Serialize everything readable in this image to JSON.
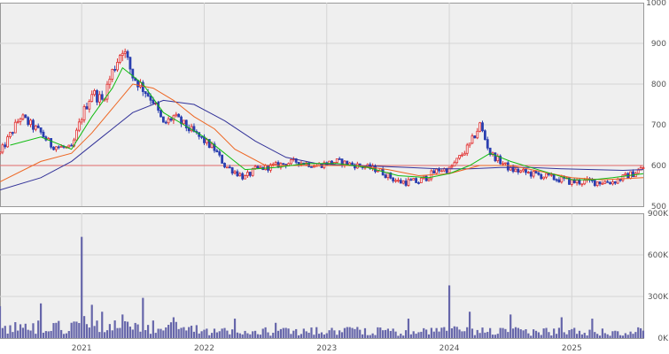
{
  "chart_data": [
    {
      "type": "candlestick",
      "panel": "price",
      "title": "",
      "x_tick_labels": [
        "2021",
        "2022",
        "2023",
        "2024",
        "2025"
      ],
      "x_range": [
        "2020-05",
        "2025-08"
      ],
      "y_ticks": [
        500,
        600,
        700,
        800,
        900,
        1000
      ],
      "y_tick_labels": [
        "500",
        "600",
        "700",
        "800",
        "900",
        "1000"
      ],
      "ylim": [
        500,
        1000
      ],
      "grid": true,
      "reference_line": 600,
      "close_series": {
        "x": [
          "2020-05",
          "2020-07",
          "2020-09",
          "2020-10",
          "2020-12",
          "2021-01",
          "2021-02",
          "2021-03",
          "2021-04",
          "2021-05",
          "2021-06",
          "2021-07",
          "2021-08",
          "2021-09",
          "2021-10",
          "2021-11",
          "2021-12",
          "2022-01",
          "2022-02",
          "2022-03",
          "2022-05",
          "2022-06",
          "2022-08",
          "2022-10",
          "2022-12",
          "2023-02",
          "2023-04",
          "2023-06",
          "2023-08",
          "2023-10",
          "2023-12",
          "2024-01",
          "2024-03",
          "2024-04",
          "2024-05",
          "2024-07",
          "2024-09",
          "2024-11",
          "2025-01",
          "2025-03",
          "2025-05",
          "2025-07",
          "2025-08"
        ],
        "y": [
          630,
          720,
          680,
          650,
          640,
          720,
          780,
          760,
          830,
          890,
          820,
          790,
          760,
          700,
          720,
          700,
          680,
          660,
          640,
          600,
          570,
          590,
          600,
          610,
          600,
          610,
          600,
          590,
          560,
          560,
          590,
          590,
          650,
          700,
          630,
          590,
          580,
          570,
          560,
          560,
          560,
          580,
          595
        ]
      },
      "ma_short": {
        "color": "#11bb11",
        "x": [
          "2020-06",
          "2020-09",
          "2020-12",
          "2021-02",
          "2021-04",
          "2021-05",
          "2021-07",
          "2021-09",
          "2021-11",
          "2022-01",
          "2022-03",
          "2022-05",
          "2022-08",
          "2022-11",
          "2023-02",
          "2023-05",
          "2023-08",
          "2023-11",
          "2024-01",
          "2024-03",
          "2024-05",
          "2024-07",
          "2024-09",
          "2024-11",
          "2025-01",
          "2025-03",
          "2025-05",
          "2025-08"
        ],
        "y": [
          650,
          670,
          640,
          720,
          790,
          840,
          800,
          730,
          700,
          670,
          630,
          590,
          595,
          605,
          605,
          595,
          575,
          570,
          580,
          600,
          630,
          610,
          595,
          580,
          565,
          565,
          570,
          580
        ]
      },
      "ma_mid": {
        "color": "#ee6622",
        "x": [
          "2020-05",
          "2020-09",
          "2020-12",
          "2021-02",
          "2021-04",
          "2021-06",
          "2021-08",
          "2021-10",
          "2021-12",
          "2022-02",
          "2022-04",
          "2022-07",
          "2022-10",
          "2023-01",
          "2023-04",
          "2023-07",
          "2023-10",
          "2024-01",
          "2024-04",
          "2024-07",
          "2024-10",
          "2025-01",
          "2025-04",
          "2025-08"
        ],
        "y": [
          560,
          610,
          630,
          680,
          740,
          800,
          790,
          760,
          720,
          690,
          640,
          600,
          600,
          600,
          600,
          590,
          575,
          580,
          600,
          600,
          585,
          570,
          565,
          570
        ]
      },
      "ma_long": {
        "color": "#333399",
        "x": [
          "2020-05",
          "2020-09",
          "2020-12",
          "2021-03",
          "2021-06",
          "2021-09",
          "2021-12",
          "2022-03",
          "2022-06",
          "2022-09",
          "2022-12",
          "2023-03",
          "2023-06",
          "2023-09",
          "2023-12",
          "2024-03",
          "2024-06",
          "2024-09",
          "2024-12",
          "2025-03",
          "2025-06",
          "2025-08"
        ],
        "y": [
          540,
          570,
          610,
          670,
          730,
          760,
          750,
          710,
          660,
          620,
          605,
          600,
          598,
          595,
          592,
          592,
          595,
          595,
          592,
          590,
          588,
          590
        ]
      }
    },
    {
      "type": "bar",
      "panel": "volume",
      "title": "",
      "y_ticks": [
        0,
        300000,
        600000,
        900000
      ],
      "y_tick_labels": [
        "0K",
        "300K",
        "600K",
        "900K"
      ],
      "ylim": [
        0,
        900000
      ],
      "grid": true,
      "color": "#6666aa",
      "baseline_volume": 40000,
      "spikes": [
        {
          "x": "2020-05",
          "value": 230000
        },
        {
          "x": "2020-09",
          "value": 250000
        },
        {
          "x": "2021-01",
          "value": 730000
        },
        {
          "x": "2021-02",
          "value": 240000
        },
        {
          "x": "2021-03",
          "value": 190000
        },
        {
          "x": "2021-05",
          "value": 170000
        },
        {
          "x": "2021-07",
          "value": 290000
        },
        {
          "x": "2021-10",
          "value": 150000
        },
        {
          "x": "2022-01",
          "value": 60000
        },
        {
          "x": "2022-04",
          "value": 140000
        },
        {
          "x": "2022-08",
          "value": 110000
        },
        {
          "x": "2023-04",
          "value": 80000
        },
        {
          "x": "2023-09",
          "value": 140000
        },
        {
          "x": "2024-01",
          "value": 380000
        },
        {
          "x": "2024-03",
          "value": 190000
        },
        {
          "x": "2024-07",
          "value": 170000
        },
        {
          "x": "2024-12",
          "value": 150000
        },
        {
          "x": "2025-03",
          "value": 140000
        }
      ]
    }
  ]
}
